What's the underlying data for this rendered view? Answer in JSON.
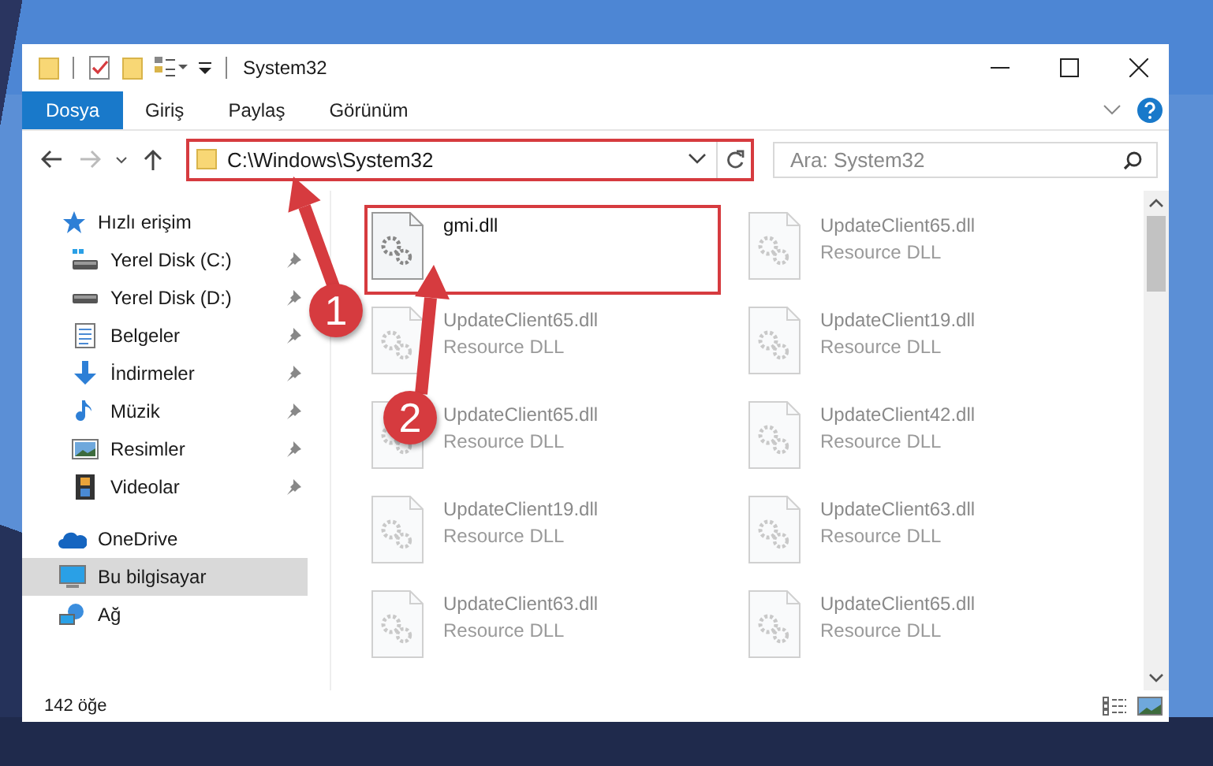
{
  "window": {
    "title": "System32"
  },
  "ribbon_tabs": [
    {
      "label": "Dosya",
      "selected": true
    },
    {
      "label": "Giriş",
      "selected": false
    },
    {
      "label": "Paylaş",
      "selected": false
    },
    {
      "label": "Görünüm",
      "selected": false
    }
  ],
  "address": {
    "path": "C:\\Windows\\System32",
    "highlighted": true
  },
  "search": {
    "placeholder": "Ara: System32"
  },
  "sidebar": {
    "items": [
      {
        "label": "Hızlı erişim",
        "kind": "star",
        "pinned": false,
        "selected": false,
        "group": true
      },
      {
        "label": "Yerel Disk (C:)",
        "kind": "system-drive",
        "pinned": true,
        "selected": false,
        "group": false
      },
      {
        "label": "Yerel Disk (D:)",
        "kind": "drive",
        "pinned": true,
        "selected": false,
        "group": false
      },
      {
        "label": "Belgeler",
        "kind": "documents",
        "pinned": true,
        "selected": false,
        "group": false
      },
      {
        "label": "İndirmeler",
        "kind": "downloads",
        "pinned": true,
        "selected": false,
        "group": false
      },
      {
        "label": "Müzik",
        "kind": "music",
        "pinned": true,
        "selected": false,
        "group": false
      },
      {
        "label": "Resimler",
        "kind": "pictures",
        "pinned": true,
        "selected": false,
        "group": false
      },
      {
        "label": "Videolar",
        "kind": "videos",
        "pinned": true,
        "selected": false,
        "group": false
      },
      {
        "label": "OneDrive",
        "kind": "cloud",
        "pinned": false,
        "selected": false,
        "group": true
      },
      {
        "label": "Bu bilgisayar",
        "kind": "computer",
        "pinned": false,
        "selected": true,
        "group": true
      },
      {
        "label": "Ağ",
        "kind": "network",
        "pinned": false,
        "selected": false,
        "group": true
      }
    ]
  },
  "files": [
    {
      "name": "gmi.dll",
      "highlighted": true,
      "dimmed": false
    },
    {
      "name": "UpdateClient65.dll",
      "subtitle": "Resource DLL",
      "highlighted": false,
      "dimmed": true
    },
    {
      "name": "UpdateClient65.dll",
      "subtitle": "Resource DLL",
      "highlighted": false,
      "dimmed": true
    },
    {
      "name": "UpdateClient19.dll",
      "subtitle": "Resource DLL",
      "highlighted": false,
      "dimmed": true
    },
    {
      "name": "UpdateClient63.dll",
      "subtitle": "Resource DLL",
      "highlighted": false,
      "dimmed": true
    },
    {
      "name": "UpdateClient65.dll",
      "subtitle": "Resource DLL",
      "highlighted": false,
      "dimmed": true
    },
    {
      "name": "UpdateClient19.dll",
      "subtitle": "Resource DLL",
      "highlighted": false,
      "dimmed": true
    },
    {
      "name": "UpdateClient42.dll",
      "subtitle": "Resource DLL",
      "highlighted": false,
      "dimmed": true
    },
    {
      "name": "UpdateClient63.dll",
      "subtitle": "Resource DLL",
      "highlighted": false,
      "dimmed": true
    },
    {
      "name": "UpdateClient65.dll",
      "subtitle": "Resource DLL",
      "highlighted": false,
      "dimmed": true
    }
  ],
  "annotations": [
    {
      "label": "1"
    },
    {
      "label": "2"
    }
  ],
  "status_bar": {
    "count": "142 öğe"
  }
}
